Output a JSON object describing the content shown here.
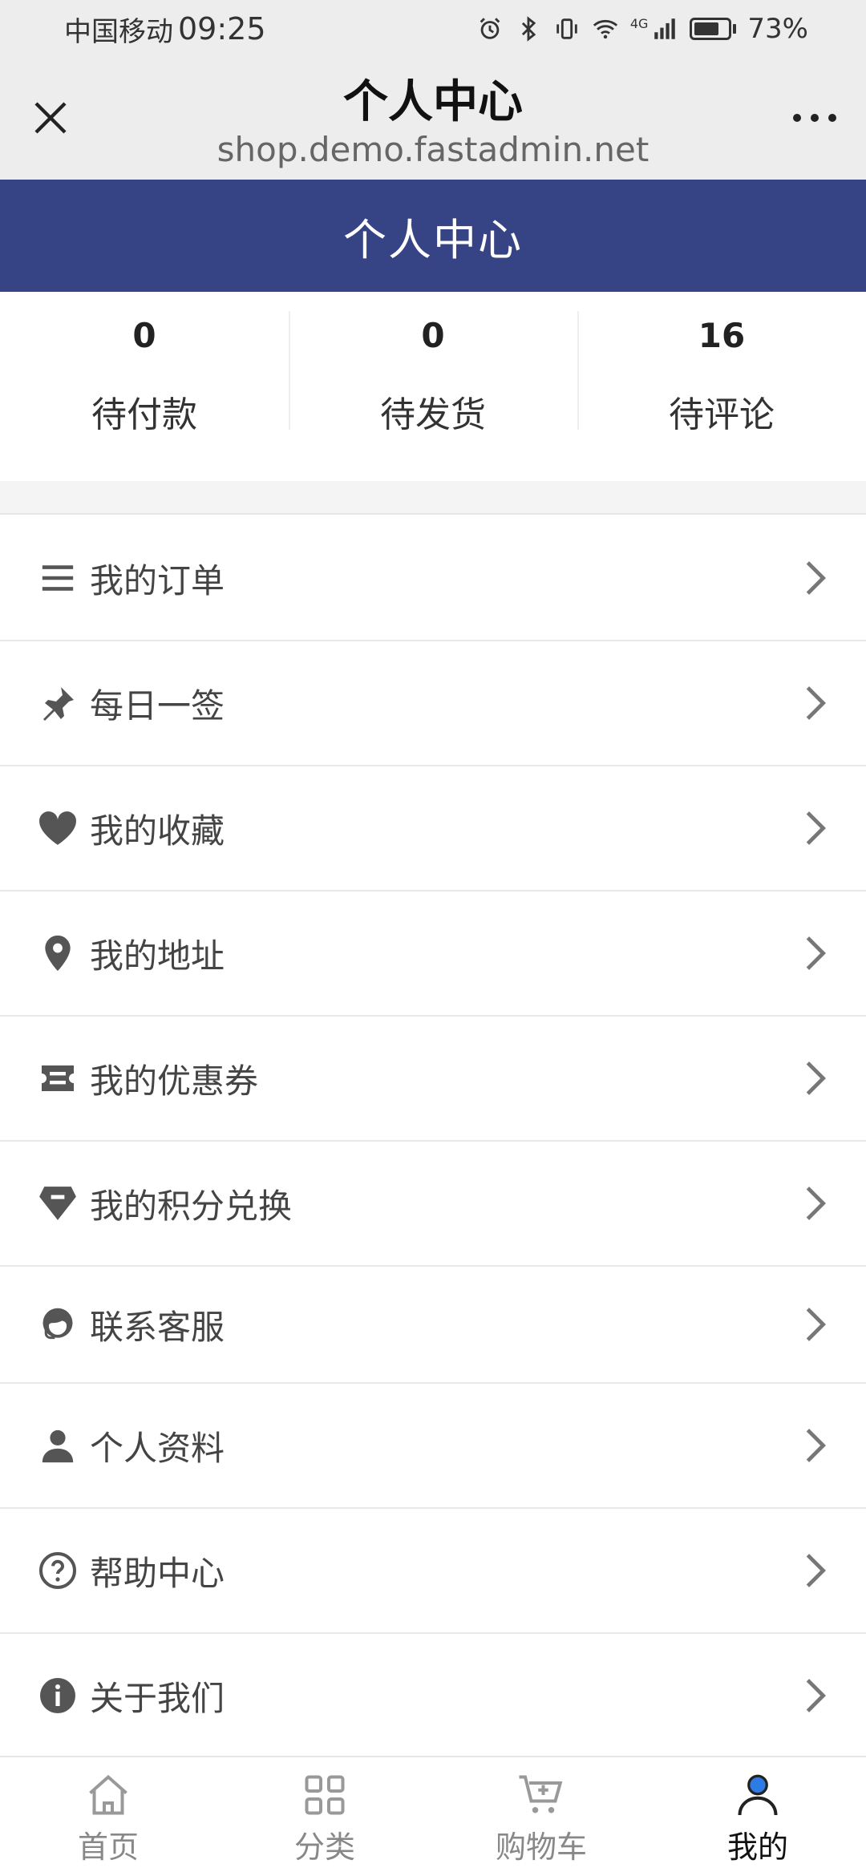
{
  "status_bar": {
    "carrier": "中国移动",
    "time": "09:25",
    "network": "4G",
    "battery": "73%",
    "battery_level": 0.73
  },
  "browser": {
    "title": "个人中心",
    "url": "shop.demo.fastadmin.net"
  },
  "header": {
    "title": "个人中心",
    "color": "#364485"
  },
  "stats": [
    {
      "value": "0",
      "label": "待付款"
    },
    {
      "value": "0",
      "label": "待发货"
    },
    {
      "value": "16",
      "label": "待评论"
    }
  ],
  "menu": [
    {
      "label": "我的订单",
      "icon": "list-icon"
    },
    {
      "label": "每日一签",
      "icon": "pin-icon"
    },
    {
      "label": "我的收藏",
      "icon": "heart-icon"
    },
    {
      "label": "我的地址",
      "icon": "location-icon"
    },
    {
      "label": "我的优惠券",
      "icon": "ticket-icon"
    },
    {
      "label": "我的积分兑换",
      "icon": "diamond-icon"
    },
    {
      "label": "联系客服",
      "icon": "customer-service-icon"
    },
    {
      "label": "个人资料",
      "icon": "user-icon"
    },
    {
      "label": "帮助中心",
      "icon": "help-icon"
    },
    {
      "label": "关于我们",
      "icon": "info-icon"
    }
  ],
  "tabbar": [
    {
      "label": "首页",
      "icon": "home-icon"
    },
    {
      "label": "分类",
      "icon": "grid-icon"
    },
    {
      "label": "购物车",
      "icon": "cart-icon"
    },
    {
      "label": "我的",
      "icon": "profile-icon",
      "active": true
    }
  ],
  "colors": {
    "accent": "#364485",
    "icon": "#555555",
    "active_dot": "#2f7be5"
  }
}
